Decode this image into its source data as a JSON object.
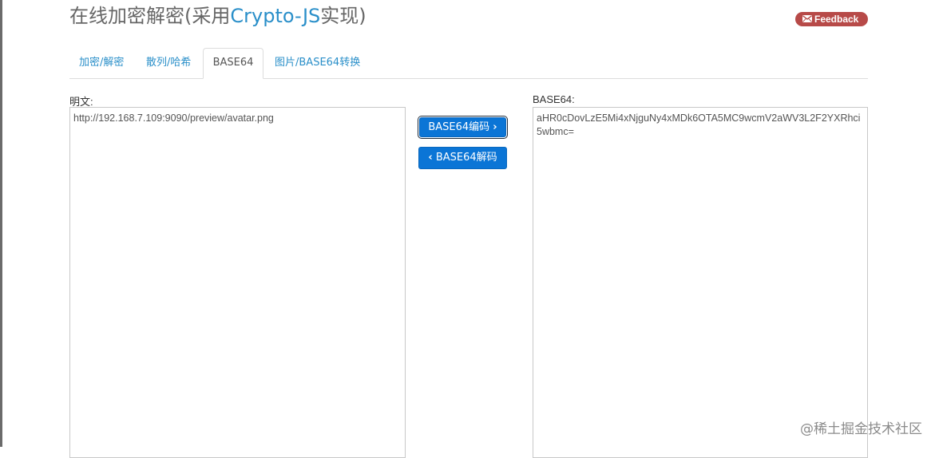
{
  "header": {
    "title_prefix": "在线加密解密(采用",
    "title_link": "Crypto-JS",
    "title_suffix": "实现)",
    "feedback_label": "Feedback"
  },
  "tabs": [
    {
      "label": "加密/解密"
    },
    {
      "label": "散列/哈希"
    },
    {
      "label": "BASE64",
      "active": true
    },
    {
      "label": "图片/BASE64转换"
    }
  ],
  "plain_text": {
    "label": "明文:",
    "value": "http://192.168.7.109:9090/preview/avatar.png"
  },
  "base64": {
    "label": "BASE64:",
    "value": "aHR0cDovLzE5Mi4xNjguNy4xMDk6OTA5MC9wcmV2aWV3L2F2YXRhci5wbmc="
  },
  "actions": {
    "encode_label": "BASE64编码",
    "decode_label": "BASE64解码"
  },
  "watermark": "@稀土掘金技术社区",
  "colors": {
    "accent": "#2a8fc9",
    "button": "#0b75d6",
    "feedback": "#b74a48"
  }
}
